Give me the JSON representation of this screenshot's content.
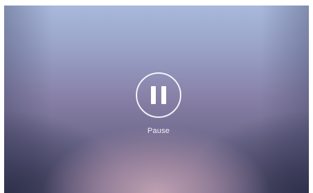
{
  "player": {
    "state": "paused",
    "control_icon": "pause-icon",
    "control_label": "Pause"
  },
  "colors": {
    "background_top": "#a8b9dc",
    "background_mid": "#877fa6",
    "background_bottom_glow": "#c4a4b4",
    "background_corners": "#282a40",
    "control_foreground": "#ffffff"
  }
}
